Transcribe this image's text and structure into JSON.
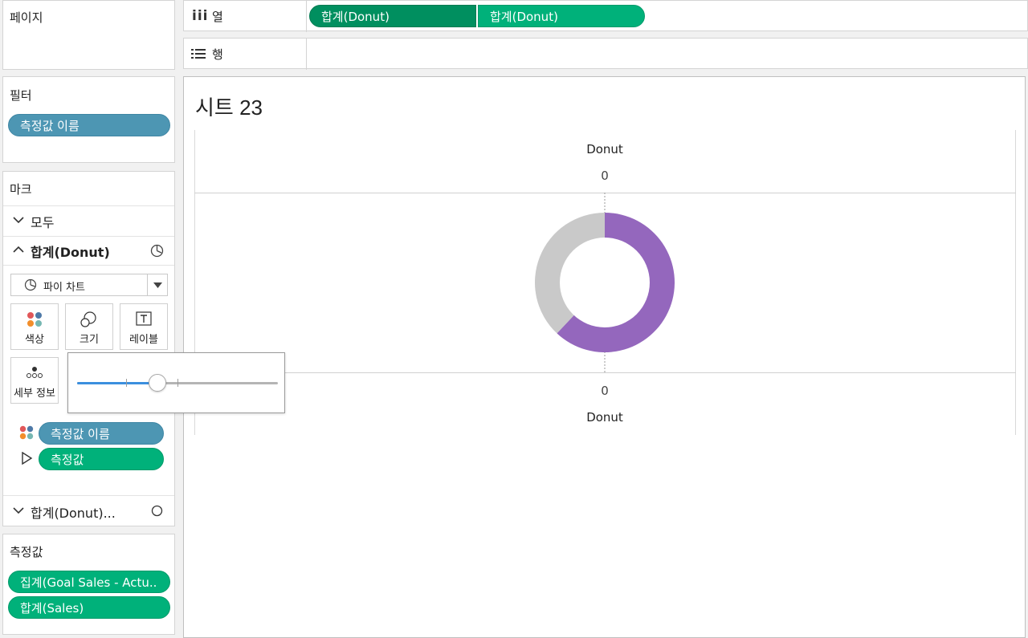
{
  "pages_panel": {
    "title": "페이지"
  },
  "columns_shelf": {
    "label": "열",
    "pills": [
      "합계(Donut)",
      "합계(Donut)"
    ]
  },
  "rows_shelf": {
    "label": "행"
  },
  "filters_panel": {
    "title": "필터",
    "pills": [
      "측정값 이름"
    ]
  },
  "marks_panel": {
    "title": "마크",
    "all_label": "모두",
    "active_layer": "합계(Donut)",
    "mark_type": "파이 차트",
    "cards": {
      "color": "색상",
      "size": "크기",
      "label": "레이블",
      "detail": "세부 정보"
    },
    "fields": [
      "측정값 이름",
      "측정값"
    ],
    "second_layer": "합계(Donut)..."
  },
  "measures_panel": {
    "title": "측정값",
    "pills": [
      "집계(Goal Sales - Actu..",
      "합계(Sales)"
    ]
  },
  "size_popup": {
    "slider_value": 0.4
  },
  "sheet": {
    "title": "시트 23",
    "top_axis_title": "Donut",
    "top_axis_tick": "0",
    "bottom_axis_tick": "0",
    "bottom_axis_title": "Donut"
  },
  "chart_data": {
    "type": "pie",
    "donut": true,
    "slices": [
      {
        "value": 0.62,
        "color": "#9467bd"
      },
      {
        "value": 0.38,
        "color": "#c9c9c9"
      }
    ]
  }
}
